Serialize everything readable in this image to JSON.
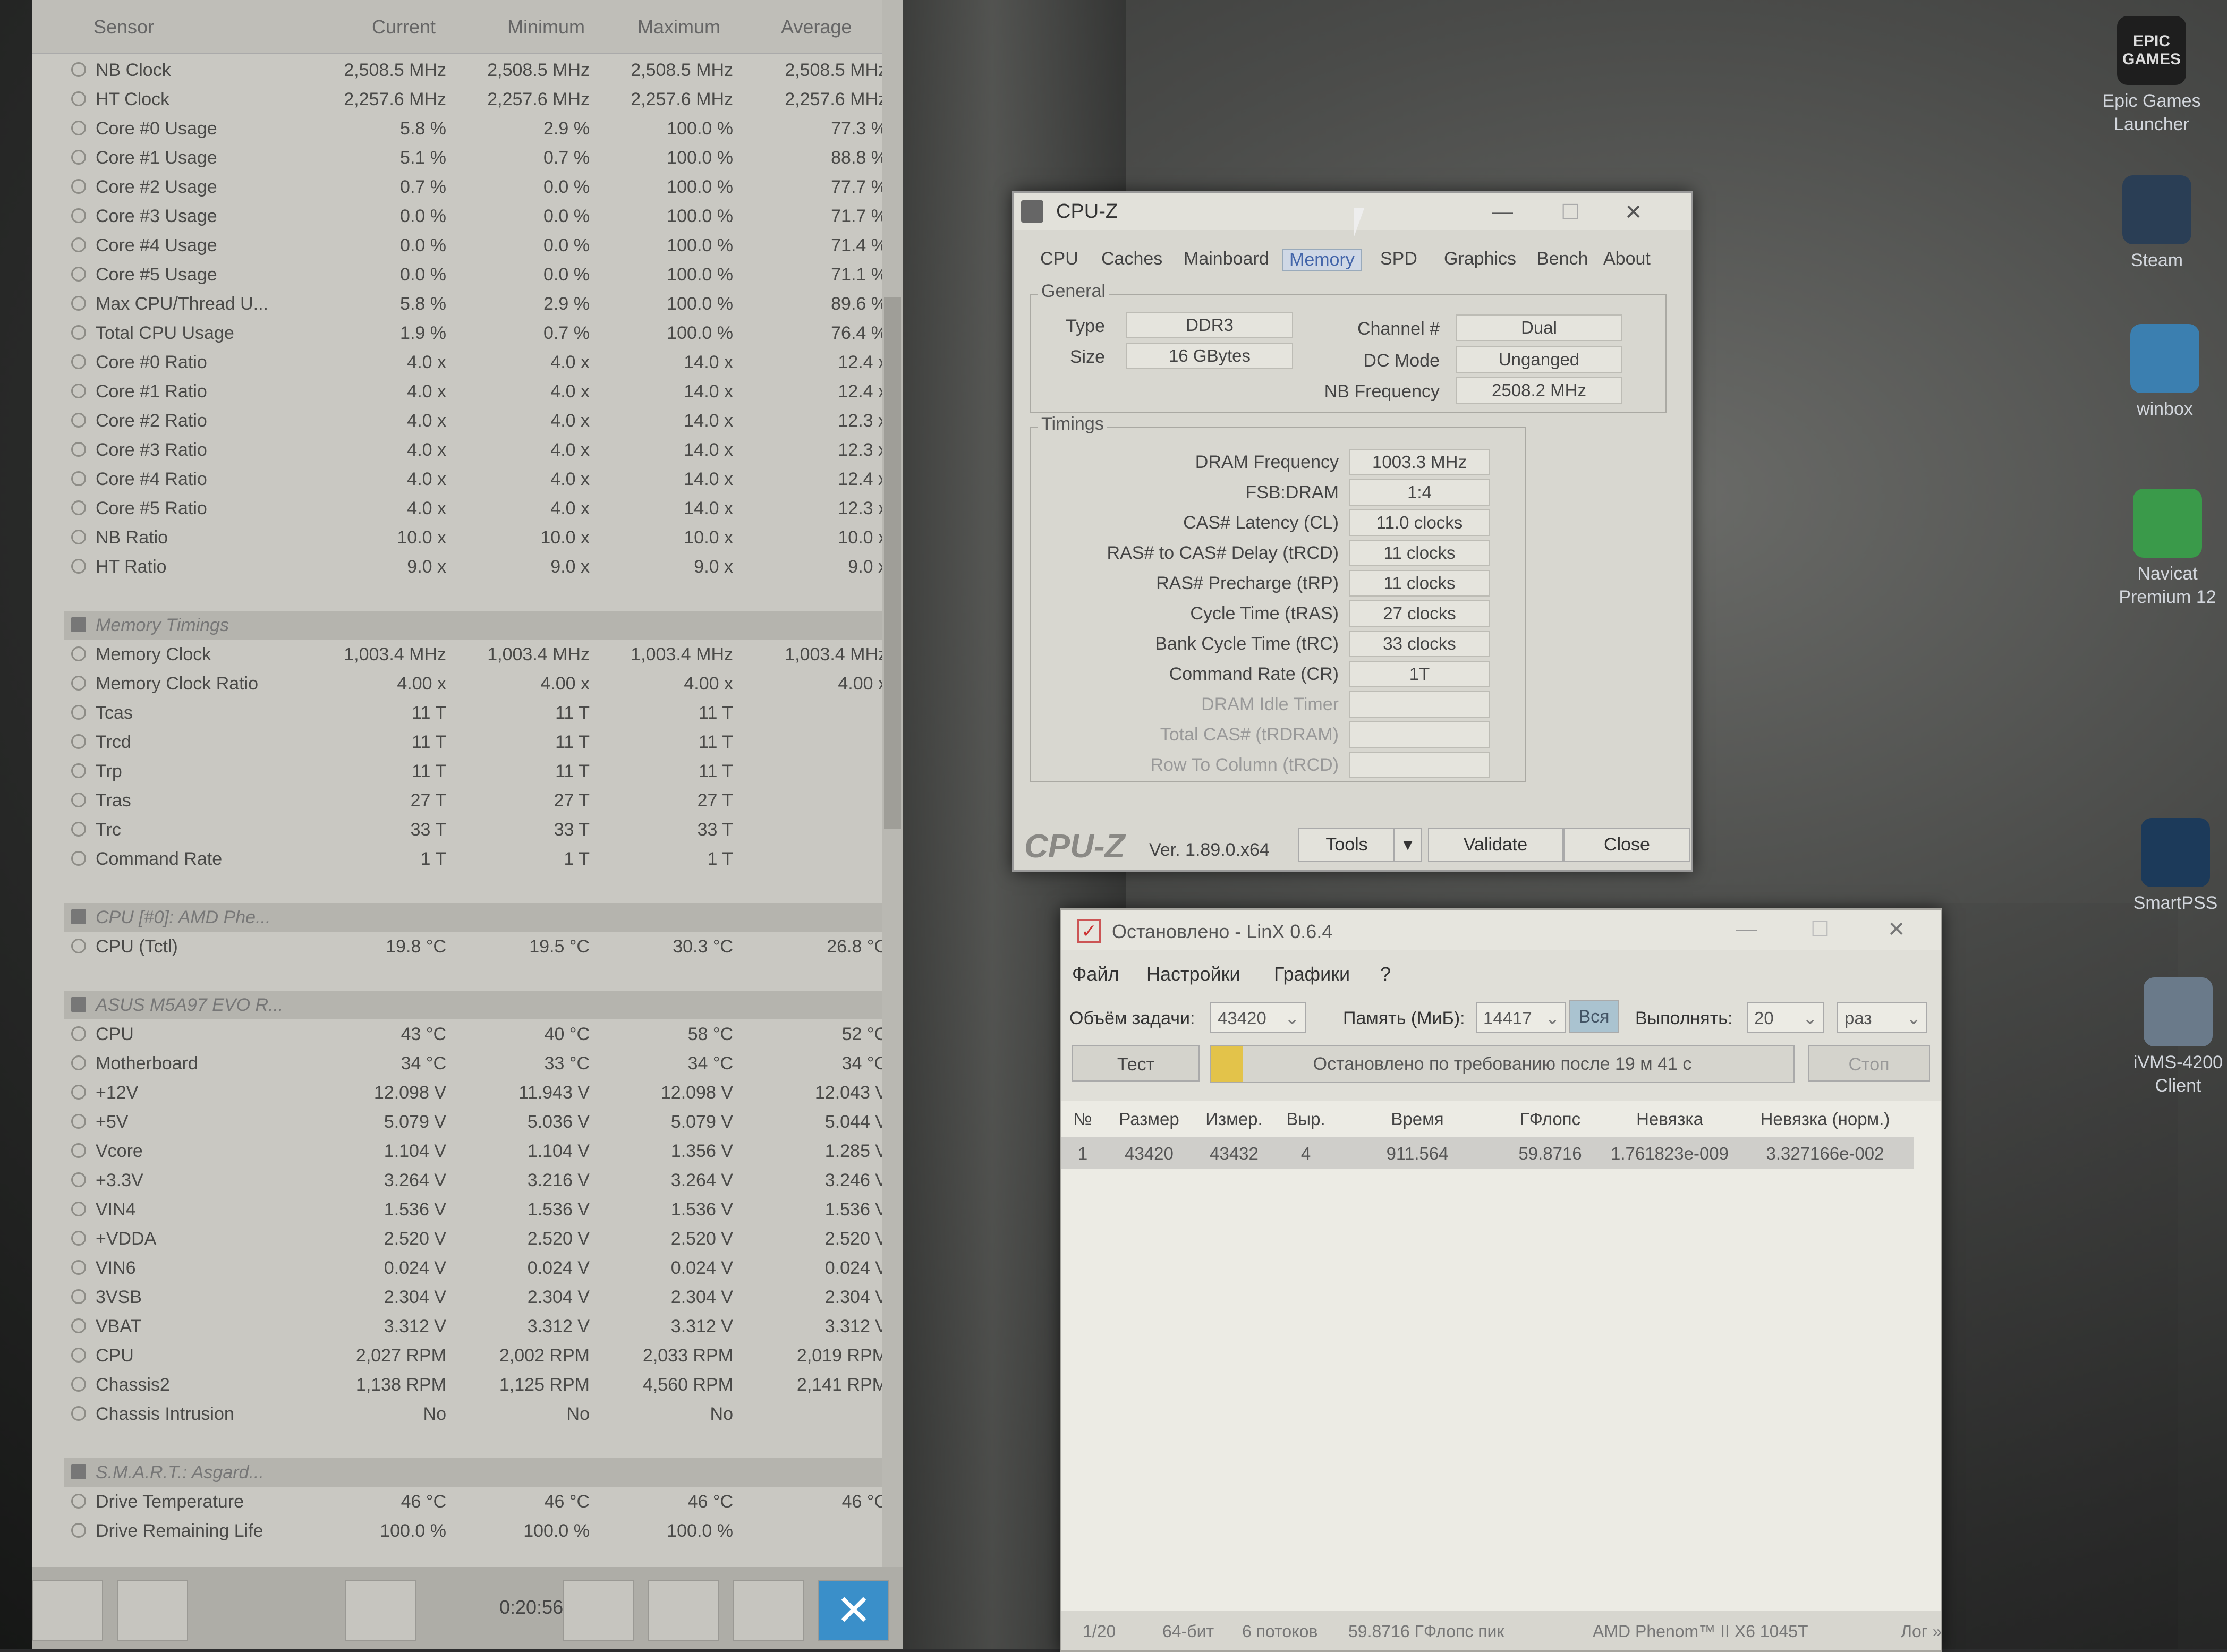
{
  "hwinfo": {
    "columns": [
      "Sensor",
      "Current",
      "Minimum",
      "Maximum",
      "Average"
    ],
    "rows": [
      {
        "label": "NB Clock",
        "cur": "2,508.5 MHz",
        "min": "2,508.5 MHz",
        "max": "2,508.5 MHz",
        "avg": "2,508.5 MHz"
      },
      {
        "label": "HT Clock",
        "cur": "2,257.6 MHz",
        "min": "2,257.6 MHz",
        "max": "2,257.6 MHz",
        "avg": "2,257.6 MHz"
      },
      {
        "label": "Core #0 Usage",
        "cur": "5.8 %",
        "min": "2.9 %",
        "max": "100.0 %",
        "avg": "77.3 %"
      },
      {
        "label": "Core #1 Usage",
        "cur": "5.1 %",
        "min": "0.7 %",
        "max": "100.0 %",
        "avg": "88.8 %"
      },
      {
        "label": "Core #2 Usage",
        "cur": "0.7 %",
        "min": "0.0 %",
        "max": "100.0 %",
        "avg": "77.7 %"
      },
      {
        "label": "Core #3 Usage",
        "cur": "0.0 %",
        "min": "0.0 %",
        "max": "100.0 %",
        "avg": "71.7 %"
      },
      {
        "label": "Core #4 Usage",
        "cur": "0.0 %",
        "min": "0.0 %",
        "max": "100.0 %",
        "avg": "71.4 %"
      },
      {
        "label": "Core #5 Usage",
        "cur": "0.0 %",
        "min": "0.0 %",
        "max": "100.0 %",
        "avg": "71.1 %"
      },
      {
        "label": "Max CPU/Thread U...",
        "cur": "5.8 %",
        "min": "2.9 %",
        "max": "100.0 %",
        "avg": "89.6 %"
      },
      {
        "label": "Total CPU Usage",
        "cur": "1.9 %",
        "min": "0.7 %",
        "max": "100.0 %",
        "avg": "76.4 %"
      },
      {
        "label": "Core #0 Ratio",
        "cur": "4.0 x",
        "min": "4.0 x",
        "max": "14.0 x",
        "avg": "12.4 x"
      },
      {
        "label": "Core #1 Ratio",
        "cur": "4.0 x",
        "min": "4.0 x",
        "max": "14.0 x",
        "avg": "12.4 x"
      },
      {
        "label": "Core #2 Ratio",
        "cur": "4.0 x",
        "min": "4.0 x",
        "max": "14.0 x",
        "avg": "12.3 x"
      },
      {
        "label": "Core #3 Ratio",
        "cur": "4.0 x",
        "min": "4.0 x",
        "max": "14.0 x",
        "avg": "12.3 x"
      },
      {
        "label": "Core #4 Ratio",
        "cur": "4.0 x",
        "min": "4.0 x",
        "max": "14.0 x",
        "avg": "12.4 x"
      },
      {
        "label": "Core #5 Ratio",
        "cur": "4.0 x",
        "min": "4.0 x",
        "max": "14.0 x",
        "avg": "12.3 x"
      },
      {
        "label": "NB Ratio",
        "cur": "10.0 x",
        "min": "10.0 x",
        "max": "10.0 x",
        "avg": "10.0 x"
      },
      {
        "label": "HT Ratio",
        "cur": "9.0 x",
        "min": "9.0 x",
        "max": "9.0 x",
        "avg": "9.0 x"
      },
      {
        "label": "",
        "cur": "",
        "min": "",
        "max": "",
        "avg": ""
      },
      {
        "label": "Memory Timings",
        "section": true,
        "cur": "",
        "min": "",
        "max": "",
        "avg": ""
      },
      {
        "label": "Memory Clock",
        "cur": "1,003.4 MHz",
        "min": "1,003.4 MHz",
        "max": "1,003.4 MHz",
        "avg": "1,003.4 MHz"
      },
      {
        "label": "Memory Clock Ratio",
        "cur": "4.00 x",
        "min": "4.00 x",
        "max": "4.00 x",
        "avg": "4.00 x"
      },
      {
        "label": "Tcas",
        "cur": "11 T",
        "min": "11 T",
        "max": "11 T",
        "avg": ""
      },
      {
        "label": "Trcd",
        "cur": "11 T",
        "min": "11 T",
        "max": "11 T",
        "avg": ""
      },
      {
        "label": "Trp",
        "cur": "11 T",
        "min": "11 T",
        "max": "11 T",
        "avg": ""
      },
      {
        "label": "Tras",
        "cur": "27 T",
        "min": "27 T",
        "max": "27 T",
        "avg": ""
      },
      {
        "label": "Trc",
        "cur": "33 T",
        "min": "33 T",
        "max": "33 T",
        "avg": ""
      },
      {
        "label": "Command Rate",
        "cur": "1 T",
        "min": "1 T",
        "max": "1 T",
        "avg": ""
      },
      {
        "label": "",
        "cur": "",
        "min": "",
        "max": "",
        "avg": ""
      },
      {
        "label": "CPU [#0]: AMD Phe...",
        "section": true,
        "cur": "",
        "min": "",
        "max": "",
        "avg": ""
      },
      {
        "label": "CPU (Tctl)",
        "cur": "19.8 °C",
        "min": "19.5 °C",
        "max": "30.3 °C",
        "avg": "26.8 °C"
      },
      {
        "label": "",
        "cur": "",
        "min": "",
        "max": "",
        "avg": ""
      },
      {
        "label": "ASUS M5A97 EVO R...",
        "section": true,
        "cur": "",
        "min": "",
        "max": "",
        "avg": ""
      },
      {
        "label": "CPU",
        "cur": "43 °C",
        "min": "40 °C",
        "max": "58 °C",
        "avg": "52 °C"
      },
      {
        "label": "Motherboard",
        "cur": "34 °C",
        "min": "33 °C",
        "max": "34 °C",
        "avg": "34 °C"
      },
      {
        "label": "+12V",
        "cur": "12.098 V",
        "min": "11.943 V",
        "max": "12.098 V",
        "avg": "12.043 V"
      },
      {
        "label": "+5V",
        "cur": "5.079 V",
        "min": "5.036 V",
        "max": "5.079 V",
        "avg": "5.044 V"
      },
      {
        "label": "Vcore",
        "cur": "1.104 V",
        "min": "1.104 V",
        "max": "1.356 V",
        "avg": "1.285 V"
      },
      {
        "label": "+3.3V",
        "cur": "3.264 V",
        "min": "3.216 V",
        "max": "3.264 V",
        "avg": "3.246 V"
      },
      {
        "label": "VIN4",
        "cur": "1.536 V",
        "min": "1.536 V",
        "max": "1.536 V",
        "avg": "1.536 V"
      },
      {
        "label": "+VDDA",
        "cur": "2.520 V",
        "min": "2.520 V",
        "max": "2.520 V",
        "avg": "2.520 V"
      },
      {
        "label": "VIN6",
        "cur": "0.024 V",
        "min": "0.024 V",
        "max": "0.024 V",
        "avg": "0.024 V"
      },
      {
        "label": "3VSB",
        "cur": "2.304 V",
        "min": "2.304 V",
        "max": "2.304 V",
        "avg": "2.304 V"
      },
      {
        "label": "VBAT",
        "cur": "3.312 V",
        "min": "3.312 V",
        "max": "3.312 V",
        "avg": "3.312 V"
      },
      {
        "label": "CPU",
        "cur": "2,027 RPM",
        "min": "2,002 RPM",
        "max": "2,033 RPM",
        "avg": "2,019 RPM"
      },
      {
        "label": "Chassis2",
        "cur": "1,138 RPM",
        "min": "1,125 RPM",
        "max": "4,560 RPM",
        "avg": "2,141 RPM"
      },
      {
        "label": "Chassis Intrusion",
        "cur": "No",
        "min": "No",
        "max": "No",
        "avg": ""
      },
      {
        "label": "",
        "cur": "",
        "min": "",
        "max": "",
        "avg": ""
      },
      {
        "label": "S.M.A.R.T.: Asgard...",
        "section": true,
        "cur": "",
        "min": "",
        "max": "",
        "avg": ""
      },
      {
        "label": "Drive Temperature",
        "cur": "46 °C",
        "min": "46 °C",
        "max": "46 °C",
        "avg": "46 °C"
      },
      {
        "label": "Drive Remaining Life",
        "cur": "100.0 %",
        "min": "100.0 %",
        "max": "100.0 %",
        "avg": ""
      }
    ],
    "elapsed": "0:20:56"
  },
  "cpuz": {
    "title": "CPU-Z",
    "tabs": [
      "CPU",
      "Caches",
      "Mainboard",
      "Memory",
      "SPD",
      "Graphics",
      "Bench",
      "About"
    ],
    "active_tab": "Memory",
    "general": {
      "legend": "General",
      "type_label": "Type",
      "type": "DDR3",
      "size_label": "Size",
      "size": "16 GBytes",
      "channel_label": "Channel #",
      "channel": "Dual",
      "dcmode_label": "DC Mode",
      "dcmode": "Unganged",
      "nbfreq_label": "NB Frequency",
      "nbfreq": "2508.2 MHz"
    },
    "timings": {
      "legend": "Timings",
      "items": [
        {
          "label": "DRAM Frequency",
          "value": "1003.3 MHz"
        },
        {
          "label": "FSB:DRAM",
          "value": "1:4"
        },
        {
          "label": "CAS# Latency (CL)",
          "value": "11.0 clocks"
        },
        {
          "label": "RAS# to CAS# Delay (tRCD)",
          "value": "11 clocks"
        },
        {
          "label": "RAS# Precharge (tRP)",
          "value": "11 clocks"
        },
        {
          "label": "Cycle Time (tRAS)",
          "value": "27 clocks"
        },
        {
          "label": "Bank Cycle Time (tRC)",
          "value": "33 clocks"
        },
        {
          "label": "Command Rate (CR)",
          "value": "1T"
        },
        {
          "label": "DRAM Idle Timer",
          "value": ""
        },
        {
          "label": "Total CAS# (tRDRAM)",
          "value": ""
        },
        {
          "label": "Row To Column (tRCD)",
          "value": ""
        }
      ]
    },
    "logo": "CPU-Z",
    "version": "Ver. 1.89.0.x64",
    "tools": "Tools",
    "validate": "Validate",
    "close": "Close"
  },
  "linx": {
    "title": "Остановлено - LinX 0.6.4",
    "menu": [
      "Файл",
      "Настройки",
      "Графики",
      "?"
    ],
    "task_label": "Объём задачи:",
    "task_value": "43420",
    "mem_label": "Память (МиБ):",
    "mem_value": "14417",
    "all_btn": "Вся",
    "run_label": "Выполнять:",
    "run_value": "20",
    "run_unit": "раз",
    "test_btn": "Тест",
    "status_text": "Остановлено по требованию после 19 м 41 с",
    "stop_btn": "Стоп",
    "columns": [
      "№",
      "Размер",
      "Измер.",
      "Выр.",
      "Время",
      "ГФлопс",
      "Невязка",
      "Невязка (норм.)"
    ],
    "rows": [
      [
        "1",
        "43420",
        "43432",
        "4",
        "911.564",
        "59.8716",
        "1.761823e-009",
        "3.327166e-002"
      ]
    ],
    "statusbar": [
      "1/20",
      "64-бит",
      "6 потоков",
      "59.8716 ГФлопс пик",
      "AMD Phenom™ II X6 1045T",
      "Лог »"
    ]
  },
  "desktop": {
    "icons": [
      {
        "name": "epic",
        "label": "Epic Games Launcher",
        "logo": "EPIC GAMES"
      },
      {
        "name": "steam",
        "label": "Steam"
      },
      {
        "name": "winbox",
        "label": "winbox"
      },
      {
        "name": "navicat",
        "label": "Navicat Premium 12"
      },
      {
        "name": "smartpss",
        "label": "SmartPSS"
      },
      {
        "name": "ivms",
        "label": "iVMS-4200 Client"
      }
    ]
  }
}
